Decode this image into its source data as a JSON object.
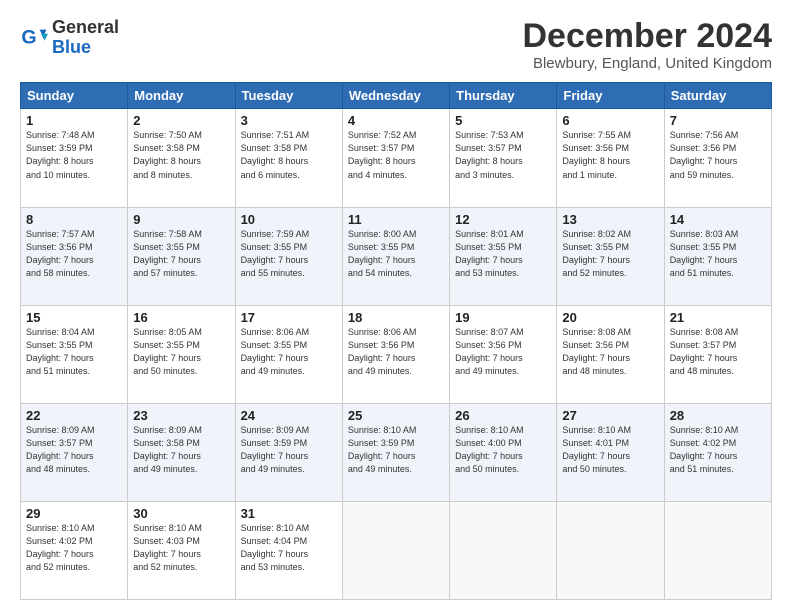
{
  "logo": {
    "general": "General",
    "blue": "Blue"
  },
  "title": "December 2024",
  "location": "Blewbury, England, United Kingdom",
  "days_of_week": [
    "Sunday",
    "Monday",
    "Tuesday",
    "Wednesday",
    "Thursday",
    "Friday",
    "Saturday"
  ],
  "weeks": [
    [
      {
        "day": "1",
        "info": "Sunrise: 7:48 AM\nSunset: 3:59 PM\nDaylight: 8 hours\nand 10 minutes."
      },
      {
        "day": "2",
        "info": "Sunrise: 7:50 AM\nSunset: 3:58 PM\nDaylight: 8 hours\nand 8 minutes."
      },
      {
        "day": "3",
        "info": "Sunrise: 7:51 AM\nSunset: 3:58 PM\nDaylight: 8 hours\nand 6 minutes."
      },
      {
        "day": "4",
        "info": "Sunrise: 7:52 AM\nSunset: 3:57 PM\nDaylight: 8 hours\nand 4 minutes."
      },
      {
        "day": "5",
        "info": "Sunrise: 7:53 AM\nSunset: 3:57 PM\nDaylight: 8 hours\nand 3 minutes."
      },
      {
        "day": "6",
        "info": "Sunrise: 7:55 AM\nSunset: 3:56 PM\nDaylight: 8 hours\nand 1 minute."
      },
      {
        "day": "7",
        "info": "Sunrise: 7:56 AM\nSunset: 3:56 PM\nDaylight: 7 hours\nand 59 minutes."
      }
    ],
    [
      {
        "day": "8",
        "info": "Sunrise: 7:57 AM\nSunset: 3:56 PM\nDaylight: 7 hours\nand 58 minutes."
      },
      {
        "day": "9",
        "info": "Sunrise: 7:58 AM\nSunset: 3:55 PM\nDaylight: 7 hours\nand 57 minutes."
      },
      {
        "day": "10",
        "info": "Sunrise: 7:59 AM\nSunset: 3:55 PM\nDaylight: 7 hours\nand 55 minutes."
      },
      {
        "day": "11",
        "info": "Sunrise: 8:00 AM\nSunset: 3:55 PM\nDaylight: 7 hours\nand 54 minutes."
      },
      {
        "day": "12",
        "info": "Sunrise: 8:01 AM\nSunset: 3:55 PM\nDaylight: 7 hours\nand 53 minutes."
      },
      {
        "day": "13",
        "info": "Sunrise: 8:02 AM\nSunset: 3:55 PM\nDaylight: 7 hours\nand 52 minutes."
      },
      {
        "day": "14",
        "info": "Sunrise: 8:03 AM\nSunset: 3:55 PM\nDaylight: 7 hours\nand 51 minutes."
      }
    ],
    [
      {
        "day": "15",
        "info": "Sunrise: 8:04 AM\nSunset: 3:55 PM\nDaylight: 7 hours\nand 51 minutes."
      },
      {
        "day": "16",
        "info": "Sunrise: 8:05 AM\nSunset: 3:55 PM\nDaylight: 7 hours\nand 50 minutes."
      },
      {
        "day": "17",
        "info": "Sunrise: 8:06 AM\nSunset: 3:55 PM\nDaylight: 7 hours\nand 49 minutes."
      },
      {
        "day": "18",
        "info": "Sunrise: 8:06 AM\nSunset: 3:56 PM\nDaylight: 7 hours\nand 49 minutes."
      },
      {
        "day": "19",
        "info": "Sunrise: 8:07 AM\nSunset: 3:56 PM\nDaylight: 7 hours\nand 49 minutes."
      },
      {
        "day": "20",
        "info": "Sunrise: 8:08 AM\nSunset: 3:56 PM\nDaylight: 7 hours\nand 48 minutes."
      },
      {
        "day": "21",
        "info": "Sunrise: 8:08 AM\nSunset: 3:57 PM\nDaylight: 7 hours\nand 48 minutes."
      }
    ],
    [
      {
        "day": "22",
        "info": "Sunrise: 8:09 AM\nSunset: 3:57 PM\nDaylight: 7 hours\nand 48 minutes."
      },
      {
        "day": "23",
        "info": "Sunrise: 8:09 AM\nSunset: 3:58 PM\nDaylight: 7 hours\nand 49 minutes."
      },
      {
        "day": "24",
        "info": "Sunrise: 8:09 AM\nSunset: 3:59 PM\nDaylight: 7 hours\nand 49 minutes."
      },
      {
        "day": "25",
        "info": "Sunrise: 8:10 AM\nSunset: 3:59 PM\nDaylight: 7 hours\nand 49 minutes."
      },
      {
        "day": "26",
        "info": "Sunrise: 8:10 AM\nSunset: 4:00 PM\nDaylight: 7 hours\nand 50 minutes."
      },
      {
        "day": "27",
        "info": "Sunrise: 8:10 AM\nSunset: 4:01 PM\nDaylight: 7 hours\nand 50 minutes."
      },
      {
        "day": "28",
        "info": "Sunrise: 8:10 AM\nSunset: 4:02 PM\nDaylight: 7 hours\nand 51 minutes."
      }
    ],
    [
      {
        "day": "29",
        "info": "Sunrise: 8:10 AM\nSunset: 4:02 PM\nDaylight: 7 hours\nand 52 minutes."
      },
      {
        "day": "30",
        "info": "Sunrise: 8:10 AM\nSunset: 4:03 PM\nDaylight: 7 hours\nand 52 minutes."
      },
      {
        "day": "31",
        "info": "Sunrise: 8:10 AM\nSunset: 4:04 PM\nDaylight: 7 hours\nand 53 minutes."
      },
      null,
      null,
      null,
      null
    ]
  ]
}
